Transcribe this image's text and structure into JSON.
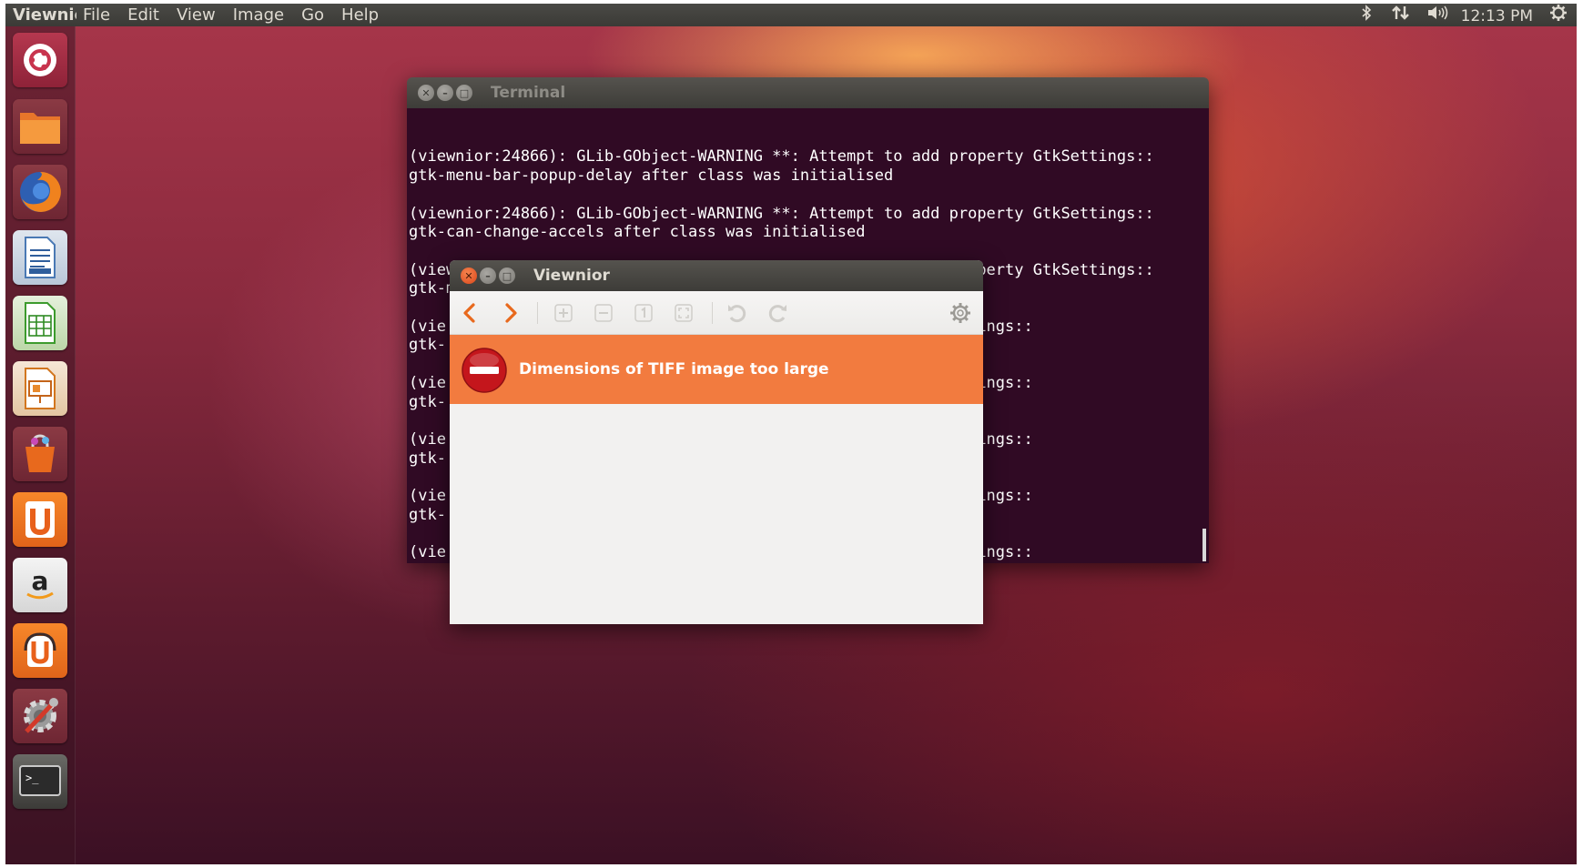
{
  "top_panel": {
    "app_name": "Viewnior",
    "menu": [
      "File",
      "Edit",
      "View",
      "Image",
      "Go",
      "Help"
    ],
    "time": "12:13 PM",
    "indicator_icons": [
      "bluetooth-icon",
      "network-icon",
      "volume-icon",
      "session-gear-icon"
    ]
  },
  "launcher": {
    "items": [
      "dash-home",
      "files",
      "firefox",
      "libreoffice-writer",
      "libreoffice-calc",
      "libreoffice-impress",
      "software-center",
      "ubuntu-one",
      "amazon",
      "ubuntu-one-music",
      "system-settings",
      "terminal"
    ]
  },
  "terminal": {
    "title": "Terminal",
    "lines": [
      "(viewnior:24866): GLib-GObject-WARNING **: Attempt to add property GtkSettings::",
      "gtk-menu-bar-popup-delay after class was initialised",
      "",
      "(viewnior:24866): GLib-GObject-WARNING **: Attempt to add property GtkSettings::",
      "gtk-can-change-accels after class was initialised",
      "",
      "(viewnior:24866): GLib-GObject-WARNING **: Attempt to add property GtkSettings::",
      "gtk-menu-popup-delay after class was initialised",
      "",
      "(vie                                         property GtkSettings::",
      "gtk-",
      "",
      "(vie                                         property GtkSettings::",
      "gtk-",
      "",
      "(vie                                         property GtkSettings::",
      "gtk-",
      "",
      "(vie                                         property GtkSettings::",
      "gtk-",
      "",
      "(vie                                         property GtkSettings::",
      "gtk-                                         ed"
    ]
  },
  "viewnior": {
    "title": "Viewnior",
    "error_message": "Dimensions of TIFF image too large",
    "accent": "#f27b3f"
  }
}
